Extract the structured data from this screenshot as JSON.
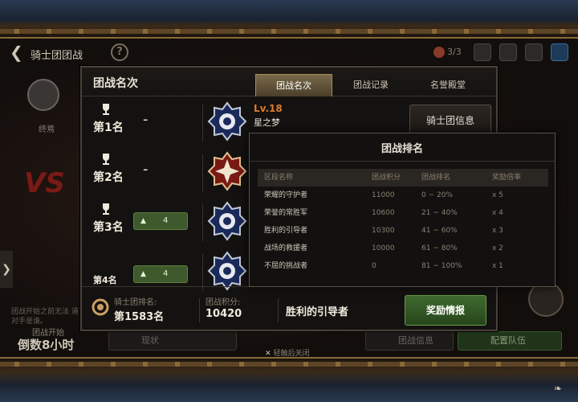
{
  "topbar": {
    "back_icon": "chevron-left-icon",
    "title": "骑士团团战",
    "help_icon": "question-mark-icon",
    "count": "3/3"
  },
  "left": {
    "final_label": "终焉",
    "note": "团战开始之前无法 道对手是谁。",
    "start_label": "团战开始",
    "countdown": "倒数8小时"
  },
  "panel": {
    "title": "团战名次",
    "tabs": [
      {
        "label": "团战名次",
        "active": true
      },
      {
        "label": "团战记录",
        "active": false
      },
      {
        "label": "名誉殿堂",
        "active": false
      }
    ],
    "ranks": [
      {
        "label": "第1名",
        "change": "-"
      },
      {
        "label": "第2名",
        "change": "-"
      },
      {
        "label": "第3名",
        "change": "4"
      },
      {
        "label": "第4名",
        "change": "4"
      }
    ],
    "first_guild": {
      "level": "Lv.18",
      "name": "星之梦"
    },
    "info_button": "骑士团信息",
    "footer": {
      "rank_label": "骑士团排名:",
      "rank_value": "第1583名",
      "score_label": "团战积分:",
      "score_value": "10420",
      "tier": "胜利的引导者",
      "reward_button": "奖励情报"
    }
  },
  "popup": {
    "title": "团战排名",
    "headers": [
      "区段名称",
      "团战积分",
      "团战排名",
      "奖励倍率"
    ],
    "rows": [
      [
        "荣耀的守护者",
        "11000",
        "0 ~ 20%",
        "x 5"
      ],
      [
        "荣誉的常胜军",
        "10600",
        "21 ~ 40%",
        "x 4"
      ],
      [
        "胜利的引导者",
        "10300",
        "41 ~ 60%",
        "x 3"
      ],
      [
        "战场的救援者",
        "10000",
        "61 ~ 80%",
        "x 2"
      ],
      [
        "不屈的挑战者",
        "0",
        "81 ~ 100%",
        "x 1"
      ]
    ]
  },
  "close_hint": "轻触后关闭",
  "bottom": {
    "status_btn": "现状",
    "info_btn": "团战信息",
    "deploy_btn": "配置队伍"
  },
  "colors": {
    "reward_green": "#3f6a2e",
    "level_orange": "#e07a2a",
    "rank_up_green": "#3e5a2c"
  }
}
